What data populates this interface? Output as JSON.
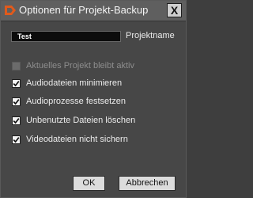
{
  "window": {
    "title": "Optionen für Projekt-Backup",
    "close_label": "X"
  },
  "project_name": {
    "value": "Test",
    "label": "Projektname"
  },
  "options": [
    {
      "label": "Aktuelles Projekt bleibt aktiv",
      "checked": false,
      "enabled": false
    },
    {
      "label": "Audiodateien minimieren",
      "checked": true,
      "enabled": true
    },
    {
      "label": "Audioprozesse festsetzen",
      "checked": true,
      "enabled": true
    },
    {
      "label": "Unbenutzte Dateien löschen",
      "checked": true,
      "enabled": true
    },
    {
      "label": "Videodateien nicht sichern",
      "checked": true,
      "enabled": true
    }
  ],
  "buttons": {
    "ok": "OK",
    "cancel": "Abbrechen"
  },
  "icons": {
    "app": "cubase-logo-icon",
    "close": "close-icon",
    "check": "checkmark-icon"
  },
  "colors": {
    "accent": "#e05a1c",
    "background": "#474747",
    "titlebar": "#5f5f5f"
  }
}
